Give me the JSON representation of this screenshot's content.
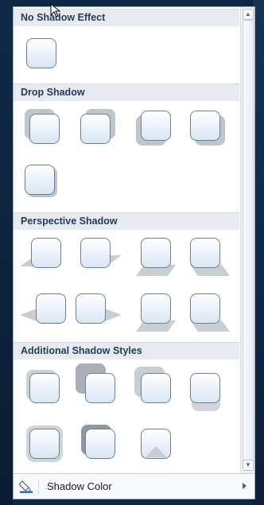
{
  "sections": {
    "no_shadow": "No Shadow Effect",
    "drop_shadow": "Drop Shadow",
    "perspective_shadow": "Perspective Shadow",
    "additional_shadow": "Additional Shadow Styles"
  },
  "footer": {
    "label": "Shadow Color",
    "icon": "paint-bucket-icon"
  },
  "colors": {
    "header_bg": "#e7ebf0",
    "header_text": "#1f3b5a",
    "shadow": "#bfc5cc"
  }
}
